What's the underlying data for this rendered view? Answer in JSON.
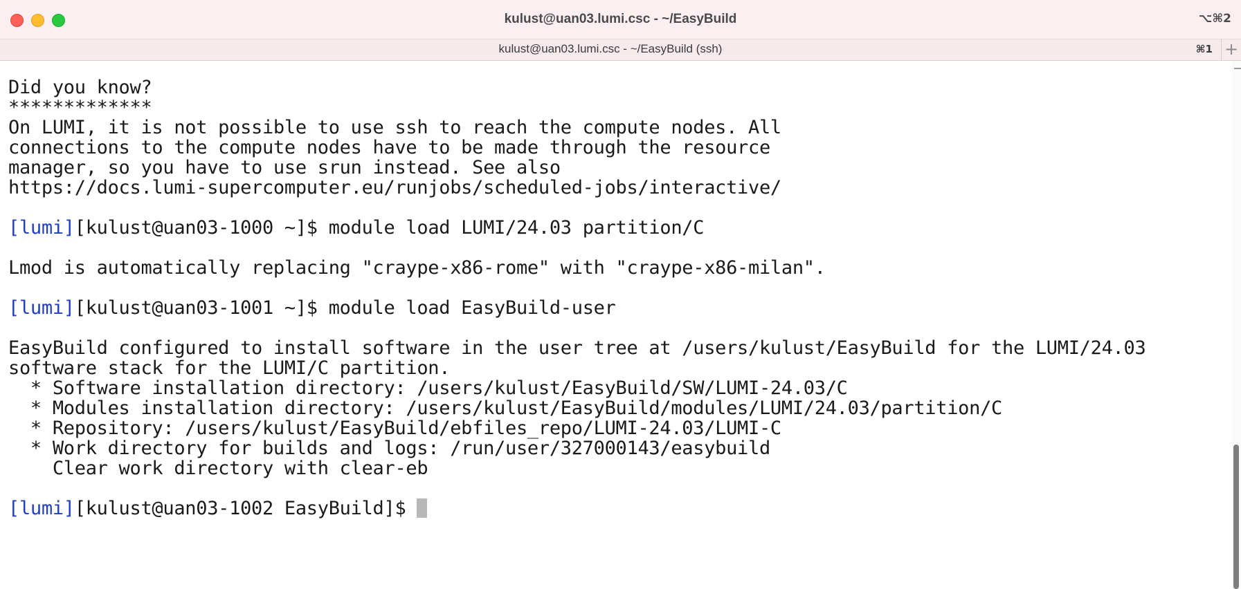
{
  "window": {
    "title": "kulust@uan03.lumi.csc - ~/EasyBuild",
    "shortcut": "⌥⌘2"
  },
  "tab": {
    "title": "kulust@uan03.lumi.csc - ~/EasyBuild (ssh)",
    "shortcut": "⌘1",
    "new_tab_icon": "+"
  },
  "terminal": {
    "lines": [
      "Did you know?",
      "*************",
      "On LUMI, it is not possible to use ssh to reach the compute nodes. All",
      "connections to the compute nodes have to be made through the resource",
      "manager, so you have to use srun instead. See also",
      "https://docs.lumi-supercomputer.eu/runjobs/scheduled-jobs/interactive/",
      "",
      "",
      "",
      "Lmod is automatically replacing \"craype-x86-rome\" with \"craype-x86-milan\".",
      "",
      "",
      "",
      "EasyBuild configured to install software in the user tree at /users/kulust/EasyBuild for the LUMI/24.03",
      "software stack for the LUMI/C partition.",
      "  * Software installation directory: /users/kulust/EasyBuild/SW/LUMI-24.03/C",
      "  * Modules installation directory: /users/kulust/EasyBuild/modules/LUMI/24.03/partition/C",
      "  * Repository: /users/kulust/EasyBuild/ebfiles_repo/LUMI-24.03/LUMI-C",
      "  * Work directory for builds and logs: /run/user/327000143/easybuild",
      "    Clear work directory with clear-eb",
      ""
    ],
    "prompts": [
      {
        "tag": "[lumi]",
        "prompt": "[kulust@uan03-1000 ~]$ ",
        "command": "module load LUMI/24.03 partition/C"
      },
      {
        "tag": "[lumi]",
        "prompt": "[kulust@uan03-1001 ~]$ ",
        "command": "module load EasyBuild-user"
      },
      {
        "tag": "[lumi]",
        "prompt": "[kulust@uan03-1002 EasyBuild]$ ",
        "command": ""
      }
    ]
  },
  "colors": {
    "prompt_tag": "#1f3ec4",
    "text": "#1a1a1a",
    "titlebar": "#fbeff1"
  }
}
